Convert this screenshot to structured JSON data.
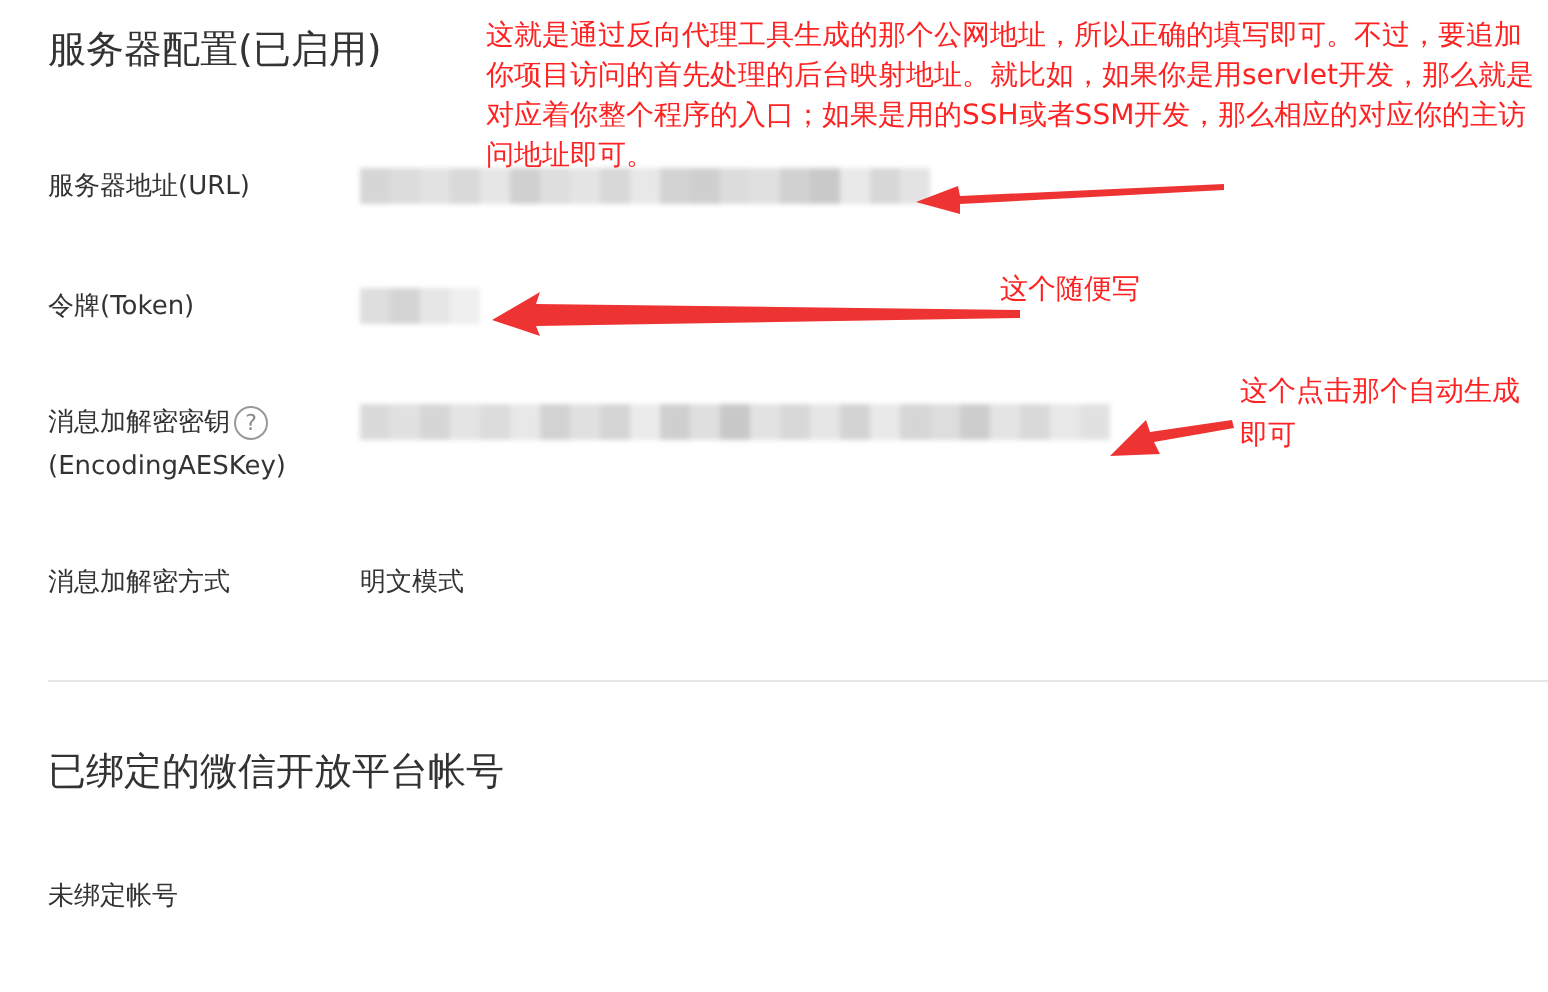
{
  "section_title": "服务器配置(已启用)",
  "fields": [
    {
      "label": "服务器地址(URL)",
      "kind": "redacted"
    },
    {
      "label": "令牌(Token)",
      "kind": "redacted"
    },
    {
      "label": "消息加解密密钥",
      "label_line2": "(EncodingAESKey)",
      "help": "?",
      "kind": "redacted"
    },
    {
      "label": "消息加解密方式",
      "kind": "text",
      "value": "明文模式"
    }
  ],
  "bound_section": {
    "title": "已绑定的微信开放平台帐号",
    "status": "未绑定帐号"
  },
  "annotations": [
    "这就是通过反向代理工具生成的那个公网地址，所以正确的填写即可。不过，要追加你项目访问的首先处理的后台映射地址。就比如，如果你是用servlet开发，那么就是对应着你整个程序的入口；如果是用的SSH或者SSM开发，那么相应的对应你的主访问地址即可。",
    "这个随便写",
    "这个点击那个自动生成即可"
  ]
}
